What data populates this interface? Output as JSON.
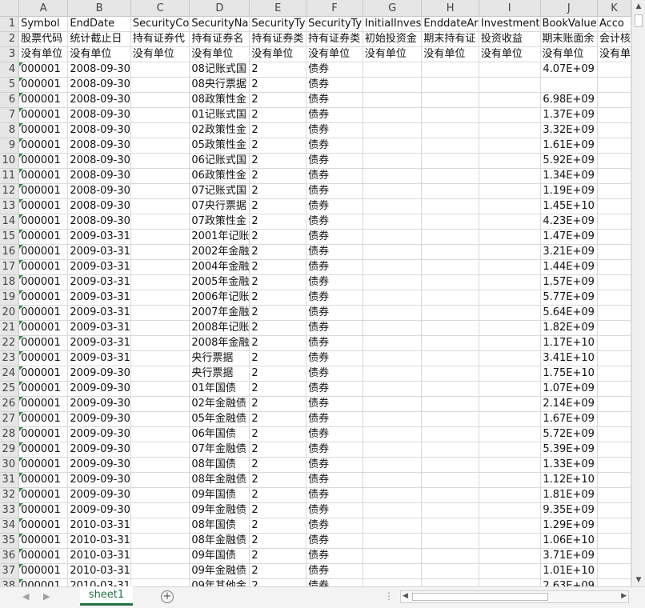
{
  "sheet": {
    "tab_label": "sheet1",
    "add_symbol": "+",
    "column_letters": [
      "A",
      "B",
      "C",
      "D",
      "E",
      "F",
      "G",
      "H",
      "I",
      "J",
      "K"
    ],
    "headers": [
      [
        "Symbol",
        "EndDate",
        "SecurityCo",
        "SecurityNa",
        "SecurityTy",
        "SecurityTy",
        "InitialInves",
        "EnddateAr",
        "Investment",
        "BookValue",
        "Acco"
      ],
      [
        "股票代码",
        "统计截止日",
        "持有证券代",
        "持有证券名",
        "持有证券类",
        "持有证券类",
        "初始投资金",
        "期末持有证",
        "投资收益",
        "期末账面余",
        "会计核"
      ],
      [
        "没有单位",
        "没有单位",
        "没有单位",
        "没有单位",
        "没有单位",
        "没有单位",
        "没有单位",
        "没有单位",
        "没有单位",
        "没有单位",
        "没有单"
      ]
    ],
    "rows": [
      [
        "000001",
        "2008-09-30",
        "",
        "08记账式国",
        "2",
        "债券",
        "",
        "",
        "",
        "4.07E+09",
        ""
      ],
      [
        "000001",
        "2008-09-30",
        "",
        "08央行票据",
        "2",
        "债券",
        "",
        "",
        "",
        "",
        ""
      ],
      [
        "000001",
        "2008-09-30",
        "",
        "08政策性金",
        "2",
        "债券",
        "",
        "",
        "",
        "6.98E+09",
        ""
      ],
      [
        "000001",
        "2008-09-30",
        "",
        "01记账式国",
        "2",
        "债券",
        "",
        "",
        "",
        "1.37E+09",
        ""
      ],
      [
        "000001",
        "2008-09-30",
        "",
        "02政策性金",
        "2",
        "债券",
        "",
        "",
        "",
        "3.32E+09",
        ""
      ],
      [
        "000001",
        "2008-09-30",
        "",
        "05政策性金",
        "2",
        "债券",
        "",
        "",
        "",
        "1.61E+09",
        ""
      ],
      [
        "000001",
        "2008-09-30",
        "",
        "06记账式国",
        "2",
        "债券",
        "",
        "",
        "",
        "5.92E+09",
        ""
      ],
      [
        "000001",
        "2008-09-30",
        "",
        "06政策性金",
        "2",
        "债券",
        "",
        "",
        "",
        "1.34E+09",
        ""
      ],
      [
        "000001",
        "2008-09-30",
        "",
        "07记账式国",
        "2",
        "债券",
        "",
        "",
        "",
        "1.19E+09",
        ""
      ],
      [
        "000001",
        "2008-09-30",
        "",
        "07央行票据",
        "2",
        "债券",
        "",
        "",
        "",
        "1.45E+10",
        ""
      ],
      [
        "000001",
        "2008-09-30",
        "",
        "07政策性金",
        "2",
        "债券",
        "",
        "",
        "",
        "4.23E+09",
        ""
      ],
      [
        "000001",
        "2009-03-31",
        "",
        "2001年记账",
        "2",
        "债券",
        "",
        "",
        "",
        "1.47E+09",
        ""
      ],
      [
        "000001",
        "2009-03-31",
        "",
        "2002年金融",
        "2",
        "债券",
        "",
        "",
        "",
        "3.21E+09",
        ""
      ],
      [
        "000001",
        "2009-03-31",
        "",
        "2004年金融",
        "2",
        "债券",
        "",
        "",
        "",
        "1.44E+09",
        ""
      ],
      [
        "000001",
        "2009-03-31",
        "",
        "2005年金融",
        "2",
        "债券",
        "",
        "",
        "",
        "1.57E+09",
        ""
      ],
      [
        "000001",
        "2009-03-31",
        "",
        "2006年记账",
        "2",
        "债券",
        "",
        "",
        "",
        "5.77E+09",
        ""
      ],
      [
        "000001",
        "2009-03-31",
        "",
        "2007年金融",
        "2",
        "债券",
        "",
        "",
        "",
        "5.64E+09",
        ""
      ],
      [
        "000001",
        "2009-03-31",
        "",
        "2008年记账",
        "2",
        "债券",
        "",
        "",
        "",
        "1.82E+09",
        ""
      ],
      [
        "000001",
        "2009-03-31",
        "",
        "2008年金融",
        "2",
        "债券",
        "",
        "",
        "",
        "1.17E+10",
        ""
      ],
      [
        "000001",
        "2009-03-31",
        "",
        "央行票据",
        "2",
        "债券",
        "",
        "",
        "",
        "3.41E+10",
        ""
      ],
      [
        "000001",
        "2009-09-30",
        "",
        "央行票据",
        "2",
        "债券",
        "",
        "",
        "",
        "1.75E+10",
        ""
      ],
      [
        "000001",
        "2009-09-30",
        "",
        "01年国债",
        "2",
        "债券",
        "",
        "",
        "",
        "1.07E+09",
        ""
      ],
      [
        "000001",
        "2009-09-30",
        "",
        "02年金融债",
        "2",
        "债券",
        "",
        "",
        "",
        "2.14E+09",
        ""
      ],
      [
        "000001",
        "2009-09-30",
        "",
        "05年金融债",
        "2",
        "债券",
        "",
        "",
        "",
        "1.67E+09",
        ""
      ],
      [
        "000001",
        "2009-09-30",
        "",
        "06年国债",
        "2",
        "债券",
        "",
        "",
        "",
        "5.72E+09",
        ""
      ],
      [
        "000001",
        "2009-09-30",
        "",
        "07年金融债",
        "2",
        "债券",
        "",
        "",
        "",
        "5.39E+09",
        ""
      ],
      [
        "000001",
        "2009-09-30",
        "",
        "08年国债",
        "2",
        "债券",
        "",
        "",
        "",
        "1.33E+09",
        ""
      ],
      [
        "000001",
        "2009-09-30",
        "",
        "08年金融债",
        "2",
        "债券",
        "",
        "",
        "",
        "1.12E+10",
        ""
      ],
      [
        "000001",
        "2009-09-30",
        "",
        "09年国债",
        "2",
        "债券",
        "",
        "",
        "",
        "1.81E+09",
        ""
      ],
      [
        "000001",
        "2009-09-30",
        "",
        "09年金融债",
        "2",
        "债券",
        "",
        "",
        "",
        "9.35E+09",
        ""
      ],
      [
        "000001",
        "2010-03-31",
        "",
        "08年国债",
        "2",
        "债券",
        "",
        "",
        "",
        "1.29E+09",
        ""
      ],
      [
        "000001",
        "2010-03-31",
        "",
        "08年金融债",
        "2",
        "债券",
        "",
        "",
        "",
        "1.06E+10",
        ""
      ],
      [
        "000001",
        "2010-03-31",
        "",
        "09年国债",
        "2",
        "债券",
        "",
        "",
        "",
        "3.71E+09",
        ""
      ],
      [
        "000001",
        "2010-03-31",
        "",
        "09年金融债",
        "2",
        "债券",
        "",
        "",
        "",
        "1.01E+10",
        ""
      ],
      [
        "000001",
        "2010-03-31",
        "",
        "09年其他金",
        "2",
        "债券",
        "",
        "",
        "",
        "2.63E+09",
        ""
      ]
    ]
  },
  "colors": {
    "accent": "#217346",
    "header_bg": "#e6e6e6",
    "gridline": "#dadada"
  },
  "icons": {
    "scroll_up": "▲",
    "scroll_down": "▼",
    "scroll_left": "◀",
    "scroll_right": "▶",
    "sheet_prev": "◀",
    "sheet_next": "▶",
    "more": "⋮"
  }
}
